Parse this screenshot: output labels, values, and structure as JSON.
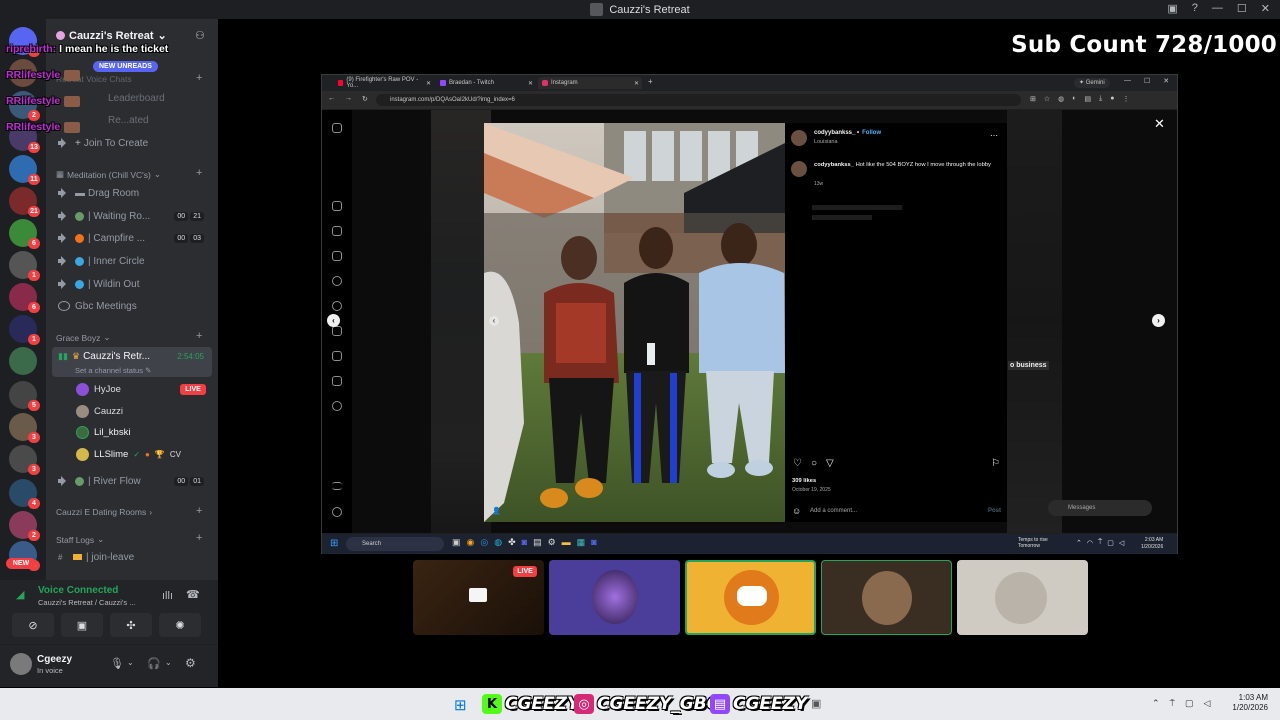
{
  "window": {
    "title": "Cauzzi's Retreat"
  },
  "server": {
    "name": "Cauzzi's Retreat"
  },
  "chat_overlay": [
    {
      "name": "riprebirth:",
      "message": "I mean he is the ticket"
    },
    {
      "name": "RRlifestyle",
      "message": ""
    },
    {
      "name": "RRlifestyle",
      "message": ""
    },
    {
      "name": "RRlifestyle",
      "message": ""
    }
  ],
  "new_unreads": "NEW UNREADS",
  "sidebar": {
    "partial_items": [
      "Retreat Voice Chats",
      "Leaderboard",
      "Re...ated"
    ],
    "join_to_create": "Join To Create",
    "categories": {
      "meditation": "Meditation (Chill VC's)",
      "grace": "Grace Boyz",
      "dating": "Cauzzi E Dating Rooms",
      "staff": "Staff Logs"
    },
    "channels": [
      {
        "label": "Drag Room",
        "counts": []
      },
      {
        "label": "| Waiting Ro...",
        "counts": [
          "00",
          "21"
        ]
      },
      {
        "label": "| Campfire ...",
        "counts": [
          "00",
          "03"
        ]
      },
      {
        "label": "| Inner Circle",
        "counts": []
      },
      {
        "label": "| Wildin Out",
        "counts": []
      },
      {
        "label": "Gbc Meetings",
        "counts": []
      }
    ],
    "active_channel": {
      "label": "Cauzzi's Retr...",
      "timer": "2:54:05",
      "status": "Set a channel status"
    },
    "users": [
      {
        "name": "HyJoe",
        "live": "LIVE"
      },
      {
        "name": "Cauzzi"
      },
      {
        "name": "Lil_kbski"
      },
      {
        "name": "LLSlime",
        "extra": "CV"
      }
    ],
    "river_flow": {
      "label": "| River Flow",
      "counts": [
        "00",
        "01"
      ]
    },
    "join_leave": "| join-leave",
    "new_badge": "NEW"
  },
  "voice_panel": {
    "status": "Voice Connected",
    "location": "Cauzzi's Retreat / Cauzzi's ..."
  },
  "user_panel": {
    "name": "Cgeezy",
    "status": "In voice"
  },
  "sub_count": "Sub Count 728/1000",
  "browser": {
    "tabs": [
      "(9) Firefighter's Raw POV - Yo...",
      "Braedan - Twitch",
      "Instagram"
    ],
    "gemini": "Gemini",
    "url": "instagram.com/p/DQAsOaI2kUd/?img_index=6"
  },
  "instagram": {
    "author": "codyybankss_",
    "follow": "Follow",
    "location": "Louisiana",
    "caption_author": "codyybankss_",
    "caption": "Hot like the 504 BOYZ how I move through the lobby",
    "age": "13w",
    "likes": "309 likes",
    "date": "October 19, 2025",
    "comment_placeholder": "Add a comment...",
    "post": "Post",
    "messages": "Messages",
    "bg_text": "o business"
  },
  "taskbar_inner": {
    "search": "Search",
    "weather": [
      "Temps to rise",
      "Tomorrow"
    ],
    "time": "2:03 AM",
    "date": "1/20/2026"
  },
  "cams": {
    "live": "LIVE"
  },
  "socials": [
    {
      "platform": "kick",
      "handle": "CGEEZY"
    },
    {
      "platform": "instagram",
      "handle": "CGEEZY_GBC"
    },
    {
      "platform": "twitch",
      "handle": "CGEEZY"
    }
  ],
  "clock": {
    "time": "1:03 AM",
    "date": "1/20/2026"
  },
  "colors": {
    "discord_bg": "#2b2d31",
    "discord_rail": "#1e1f22",
    "live_red": "#f23f43",
    "blurple": "#5865f2",
    "green": "#23a55a",
    "chat_name": "#c22bd6"
  }
}
